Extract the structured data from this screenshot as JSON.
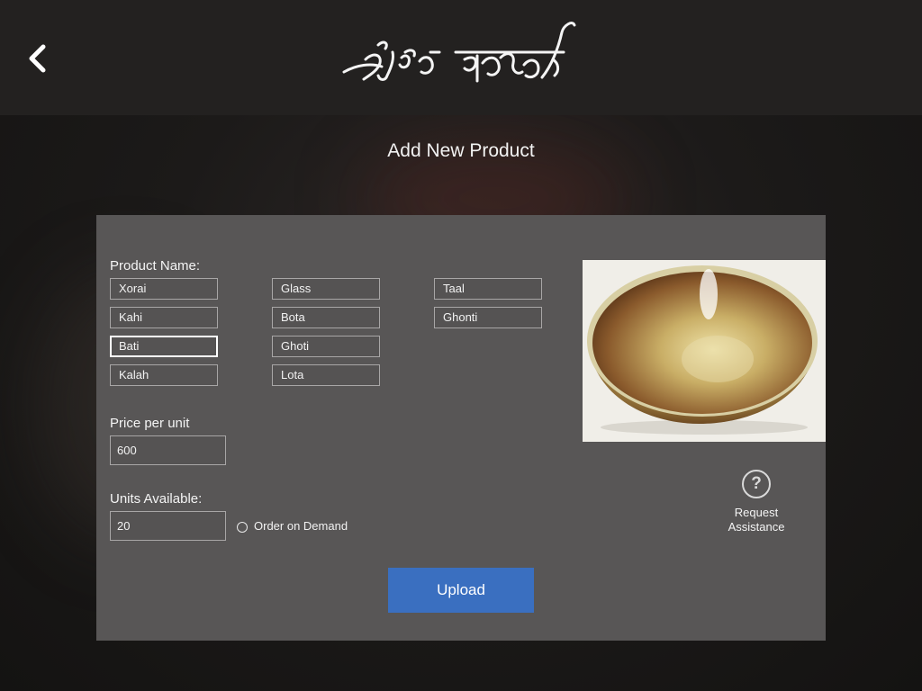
{
  "header": {
    "back_icon": "chevron-left-icon",
    "logo_text": "কাঁহিৰ পশাৰি"
  },
  "page": {
    "title": "Add New Product"
  },
  "form": {
    "product_name_label": "Product Name:",
    "product_options": [
      "Xorai",
      "Glass",
      "Taal",
      "Kahi",
      "Bota",
      "Ghonti",
      "Bati",
      "Ghoti",
      "Kalah",
      "Lota"
    ],
    "selected_product": "Bati",
    "price_label": "Price per unit",
    "price_value": "600",
    "units_label": "Units Available:",
    "units_value": "20",
    "order_on_demand_label": "Order on Demand",
    "order_on_demand_checked": false,
    "upload_label": "Upload"
  },
  "assistance": {
    "icon": "question-circle-icon",
    "icon_glyph": "?",
    "line1": "Request",
    "line2": "Assistance"
  },
  "colors": {
    "panel": "#585656",
    "upload_button": "#3a6fc0",
    "topbar": "#232120"
  }
}
